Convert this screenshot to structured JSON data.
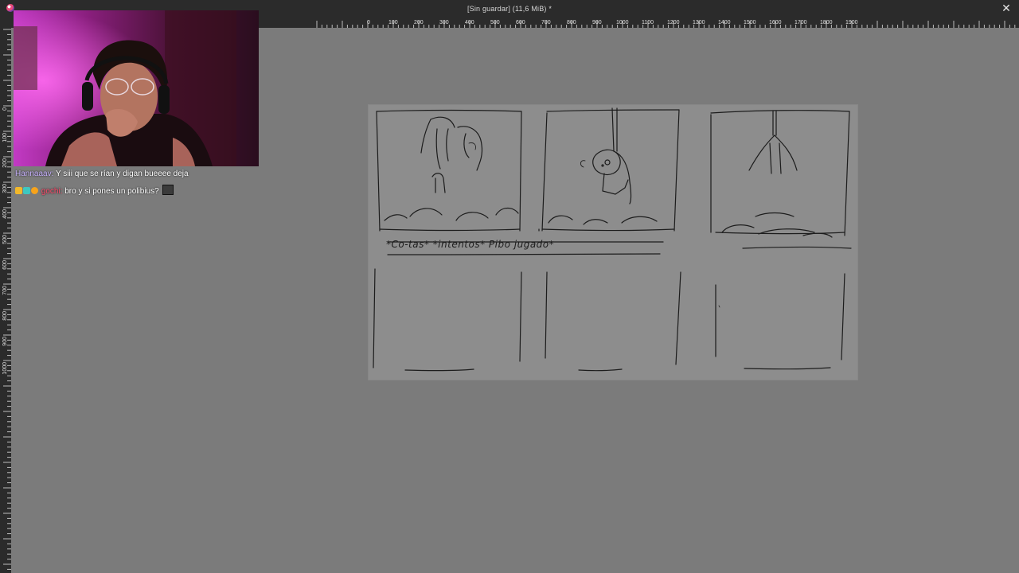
{
  "window": {
    "title": "[Sin guardar]  (11,6 MiB) *",
    "close_icon": "close-icon",
    "app_icon": "app-logo-icon"
  },
  "ruler_top": {
    "labels": [
      "0",
      "100",
      "200",
      "300",
      "400",
      "500",
      "600",
      "700",
      "800",
      "900",
      "1000",
      "1100",
      "1200",
      "1300",
      "1400",
      "1500",
      "1600",
      "1700",
      "1800",
      "1900"
    ]
  },
  "ruler_left": {
    "labels": [
      "0",
      "100",
      "200",
      "300",
      "400",
      "500",
      "600",
      "700",
      "800",
      "900",
      "1000"
    ]
  },
  "canvas": {
    "caption": "*Co-tas* *intentos* Pibo jugado*"
  },
  "chat": {
    "messages": [
      {
        "user": "Hannaaav:",
        "text": "Y siii que se rían y digan bueeee deja",
        "user_color": "#c9b3ff"
      },
      {
        "user": "gochi:",
        "text": "bro y si pones un polibius?",
        "user_color": "#ff4d6d"
      }
    ]
  },
  "colors": {
    "background": "#7b7b7b",
    "paper": "#8d8d8d",
    "ui_dark": "#2b2b2b",
    "sketch_line": "#1c1c1c"
  }
}
